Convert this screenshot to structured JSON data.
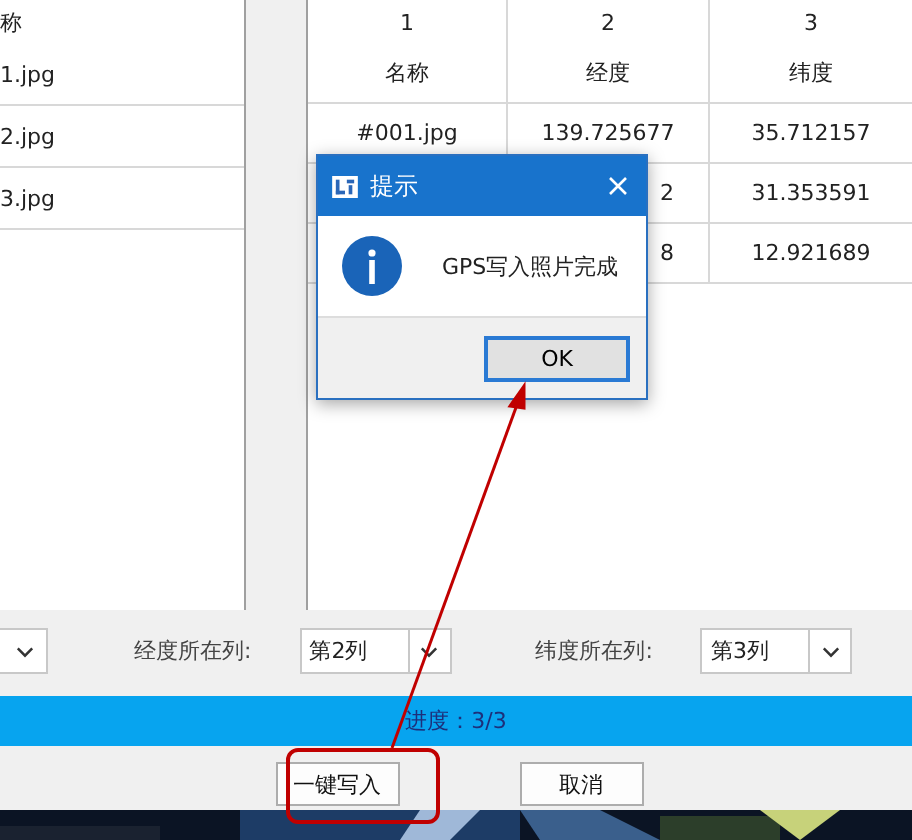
{
  "left_table": {
    "header": "称",
    "rows": [
      "1.jpg",
      "2.jpg",
      "3.jpg"
    ]
  },
  "right_table": {
    "column_numbers": [
      "1",
      "2",
      "3"
    ],
    "columns": [
      "名称",
      "经度",
      "纬度"
    ],
    "rows": [
      [
        "#001.jpg",
        "139.725677",
        "35.712157"
      ],
      [
        "2",
        "31.353591"
      ],
      [
        "8",
        "12.921689"
      ]
    ]
  },
  "selects": [
    {
      "label": "经度所在列:",
      "value": "第2列"
    },
    {
      "label": "纬度所在列:",
      "value": "第3列"
    }
  ],
  "progress": {
    "level": 1,
    "text": "进度：3/3"
  },
  "buttons": [
    "一键写入",
    "取消"
  ],
  "dialog": {
    "title": "提示",
    "message": "GPS写入照片完成",
    "button": "OK"
  }
}
